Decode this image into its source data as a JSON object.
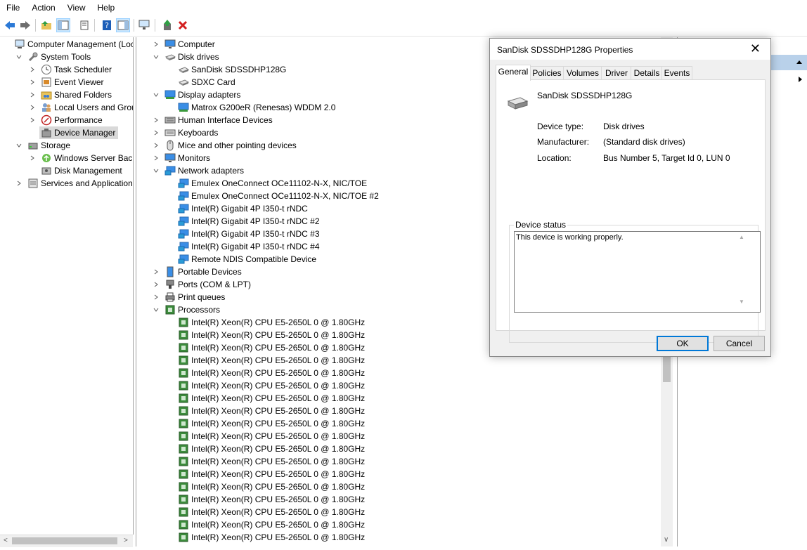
{
  "menu": [
    "File",
    "Action",
    "View",
    "Help"
  ],
  "left_tree": [
    {
      "label": "Computer Management (Local",
      "depth": 0,
      "expander": "",
      "icon": "computer-management-icon"
    },
    {
      "label": "System Tools",
      "depth": 1,
      "expander": "v",
      "icon": "system-tools-icon"
    },
    {
      "label": "Task Scheduler",
      "depth": 2,
      "expander": ">",
      "icon": "clock-icon"
    },
    {
      "label": "Event Viewer",
      "depth": 2,
      "expander": ">",
      "icon": "event-viewer-icon"
    },
    {
      "label": "Shared Folders",
      "depth": 2,
      "expander": ">",
      "icon": "shared-folder-icon"
    },
    {
      "label": "Local Users and Groups",
      "depth": 2,
      "expander": ">",
      "icon": "users-icon"
    },
    {
      "label": "Performance",
      "depth": 2,
      "expander": ">",
      "icon": "performance-icon"
    },
    {
      "label": "Device Manager",
      "depth": 2,
      "expander": "",
      "icon": "device-manager-icon",
      "selected": true
    },
    {
      "label": "Storage",
      "depth": 1,
      "expander": "v",
      "icon": "storage-icon"
    },
    {
      "label": "Windows Server Backup",
      "depth": 2,
      "expander": ">",
      "icon": "backup-icon"
    },
    {
      "label": "Disk Management",
      "depth": 2,
      "expander": "",
      "icon": "disk-management-icon"
    },
    {
      "label": "Services and Applications",
      "depth": 1,
      "expander": ">",
      "icon": "services-icon"
    }
  ],
  "device_tree": [
    {
      "label": "Computer",
      "depth": 0,
      "expander": ">",
      "icon": "monitor-icon"
    },
    {
      "label": "Disk drives",
      "depth": 0,
      "expander": "v",
      "icon": "disk-drive-icon"
    },
    {
      "label": "SanDisk SDSSDHP128G",
      "depth": 1,
      "expander": "",
      "icon": "disk-drive-icon"
    },
    {
      "label": "SDXC Card",
      "depth": 1,
      "expander": "",
      "icon": "disk-drive-icon"
    },
    {
      "label": "Display adapters",
      "depth": 0,
      "expander": "v",
      "icon": "display-adapter-icon"
    },
    {
      "label": "Matrox G200eR (Renesas) WDDM 2.0",
      "depth": 1,
      "expander": "",
      "icon": "display-adapter-icon"
    },
    {
      "label": "Human Interface Devices",
      "depth": 0,
      "expander": ">",
      "icon": "hid-icon"
    },
    {
      "label": "Keyboards",
      "depth": 0,
      "expander": ">",
      "icon": "keyboard-icon"
    },
    {
      "label": "Mice and other pointing devices",
      "depth": 0,
      "expander": ">",
      "icon": "mouse-icon"
    },
    {
      "label": "Monitors",
      "depth": 0,
      "expander": ">",
      "icon": "monitor-icon"
    },
    {
      "label": "Network adapters",
      "depth": 0,
      "expander": "v",
      "icon": "network-adapter-icon"
    },
    {
      "label": "Emulex OneConnect OCe11102-N-X, NIC/TOE",
      "depth": 1,
      "expander": "",
      "icon": "network-adapter-icon"
    },
    {
      "label": "Emulex OneConnect OCe11102-N-X, NIC/TOE #2",
      "depth": 1,
      "expander": "",
      "icon": "network-adapter-icon"
    },
    {
      "label": "Intel(R) Gigabit 4P I350-t rNDC",
      "depth": 1,
      "expander": "",
      "icon": "network-adapter-icon"
    },
    {
      "label": "Intel(R) Gigabit 4P I350-t rNDC #2",
      "depth": 1,
      "expander": "",
      "icon": "network-adapter-icon"
    },
    {
      "label": "Intel(R) Gigabit 4P I350-t rNDC #3",
      "depth": 1,
      "expander": "",
      "icon": "network-adapter-icon"
    },
    {
      "label": "Intel(R) Gigabit 4P I350-t rNDC #4",
      "depth": 1,
      "expander": "",
      "icon": "network-adapter-icon"
    },
    {
      "label": "Remote NDIS Compatible Device",
      "depth": 1,
      "expander": "",
      "icon": "network-adapter-icon"
    },
    {
      "label": "Portable Devices",
      "depth": 0,
      "expander": ">",
      "icon": "portable-device-icon"
    },
    {
      "label": "Ports (COM & LPT)",
      "depth": 0,
      "expander": ">",
      "icon": "port-icon"
    },
    {
      "label": "Print queues",
      "depth": 0,
      "expander": ">",
      "icon": "printer-icon"
    },
    {
      "label": "Processors",
      "depth": 0,
      "expander": "v",
      "icon": "processor-icon"
    },
    {
      "label": "Intel(R) Xeon(R) CPU E5-2650L 0 @ 1.80GHz",
      "depth": 1,
      "expander": "",
      "icon": "processor-icon"
    },
    {
      "label": "Intel(R) Xeon(R) CPU E5-2650L 0 @ 1.80GHz",
      "depth": 1,
      "expander": "",
      "icon": "processor-icon"
    },
    {
      "label": "Intel(R) Xeon(R) CPU E5-2650L 0 @ 1.80GHz",
      "depth": 1,
      "expander": "",
      "icon": "processor-icon"
    },
    {
      "label": "Intel(R) Xeon(R) CPU E5-2650L 0 @ 1.80GHz",
      "depth": 1,
      "expander": "",
      "icon": "processor-icon"
    },
    {
      "label": "Intel(R) Xeon(R) CPU E5-2650L 0 @ 1.80GHz",
      "depth": 1,
      "expander": "",
      "icon": "processor-icon"
    },
    {
      "label": "Intel(R) Xeon(R) CPU E5-2650L 0 @ 1.80GHz",
      "depth": 1,
      "expander": "",
      "icon": "processor-icon"
    },
    {
      "label": "Intel(R) Xeon(R) CPU E5-2650L 0 @ 1.80GHz",
      "depth": 1,
      "expander": "",
      "icon": "processor-icon"
    },
    {
      "label": "Intel(R) Xeon(R) CPU E5-2650L 0 @ 1.80GHz",
      "depth": 1,
      "expander": "",
      "icon": "processor-icon"
    },
    {
      "label": "Intel(R) Xeon(R) CPU E5-2650L 0 @ 1.80GHz",
      "depth": 1,
      "expander": "",
      "icon": "processor-icon"
    },
    {
      "label": "Intel(R) Xeon(R) CPU E5-2650L 0 @ 1.80GHz",
      "depth": 1,
      "expander": "",
      "icon": "processor-icon"
    },
    {
      "label": "Intel(R) Xeon(R) CPU E5-2650L 0 @ 1.80GHz",
      "depth": 1,
      "expander": "",
      "icon": "processor-icon"
    },
    {
      "label": "Intel(R) Xeon(R) CPU E5-2650L 0 @ 1.80GHz",
      "depth": 1,
      "expander": "",
      "icon": "processor-icon"
    },
    {
      "label": "Intel(R) Xeon(R) CPU E5-2650L 0 @ 1.80GHz",
      "depth": 1,
      "expander": "",
      "icon": "processor-icon"
    },
    {
      "label": "Intel(R) Xeon(R) CPU E5-2650L 0 @ 1.80GHz",
      "depth": 1,
      "expander": "",
      "icon": "processor-icon"
    },
    {
      "label": "Intel(R) Xeon(R) CPU E5-2650L 0 @ 1.80GHz",
      "depth": 1,
      "expander": "",
      "icon": "processor-icon"
    },
    {
      "label": "Intel(R) Xeon(R) CPU E5-2650L 0 @ 1.80GHz",
      "depth": 1,
      "expander": "",
      "icon": "processor-icon"
    },
    {
      "label": "Intel(R) Xeon(R) CPU E5-2650L 0 @ 1.80GHz",
      "depth": 1,
      "expander": "",
      "icon": "processor-icon"
    },
    {
      "label": "Intel(R) Xeon(R) CPU E5-2650L 0 @ 1.80GHz",
      "depth": 1,
      "expander": "",
      "icon": "processor-icon"
    }
  ],
  "dialog": {
    "title": "SanDisk SDSSDHP128G Properties",
    "tabs": [
      "General",
      "Policies",
      "Volumes",
      "Driver",
      "Details",
      "Events"
    ],
    "active_tab": "General",
    "device_name": "SanDisk SDSSDHP128G",
    "fields": {
      "device_type_label": "Device type:",
      "device_type": "Disk drives",
      "manufacturer_label": "Manufacturer:",
      "manufacturer": "(Standard disk drives)",
      "location_label": "Location:",
      "location": "Bus Number 5, Target Id 0, LUN 0"
    },
    "status_legend": "Device status",
    "status_text": "This device is working properly.",
    "ok_label": "OK",
    "cancel_label": "Cancel"
  },
  "colors": {
    "selection_bg": "#d9d9d9",
    "dialog_bg": "#f0f0f0",
    "default_button_border": "#0078d7",
    "right_header": "#b9d1ea"
  }
}
